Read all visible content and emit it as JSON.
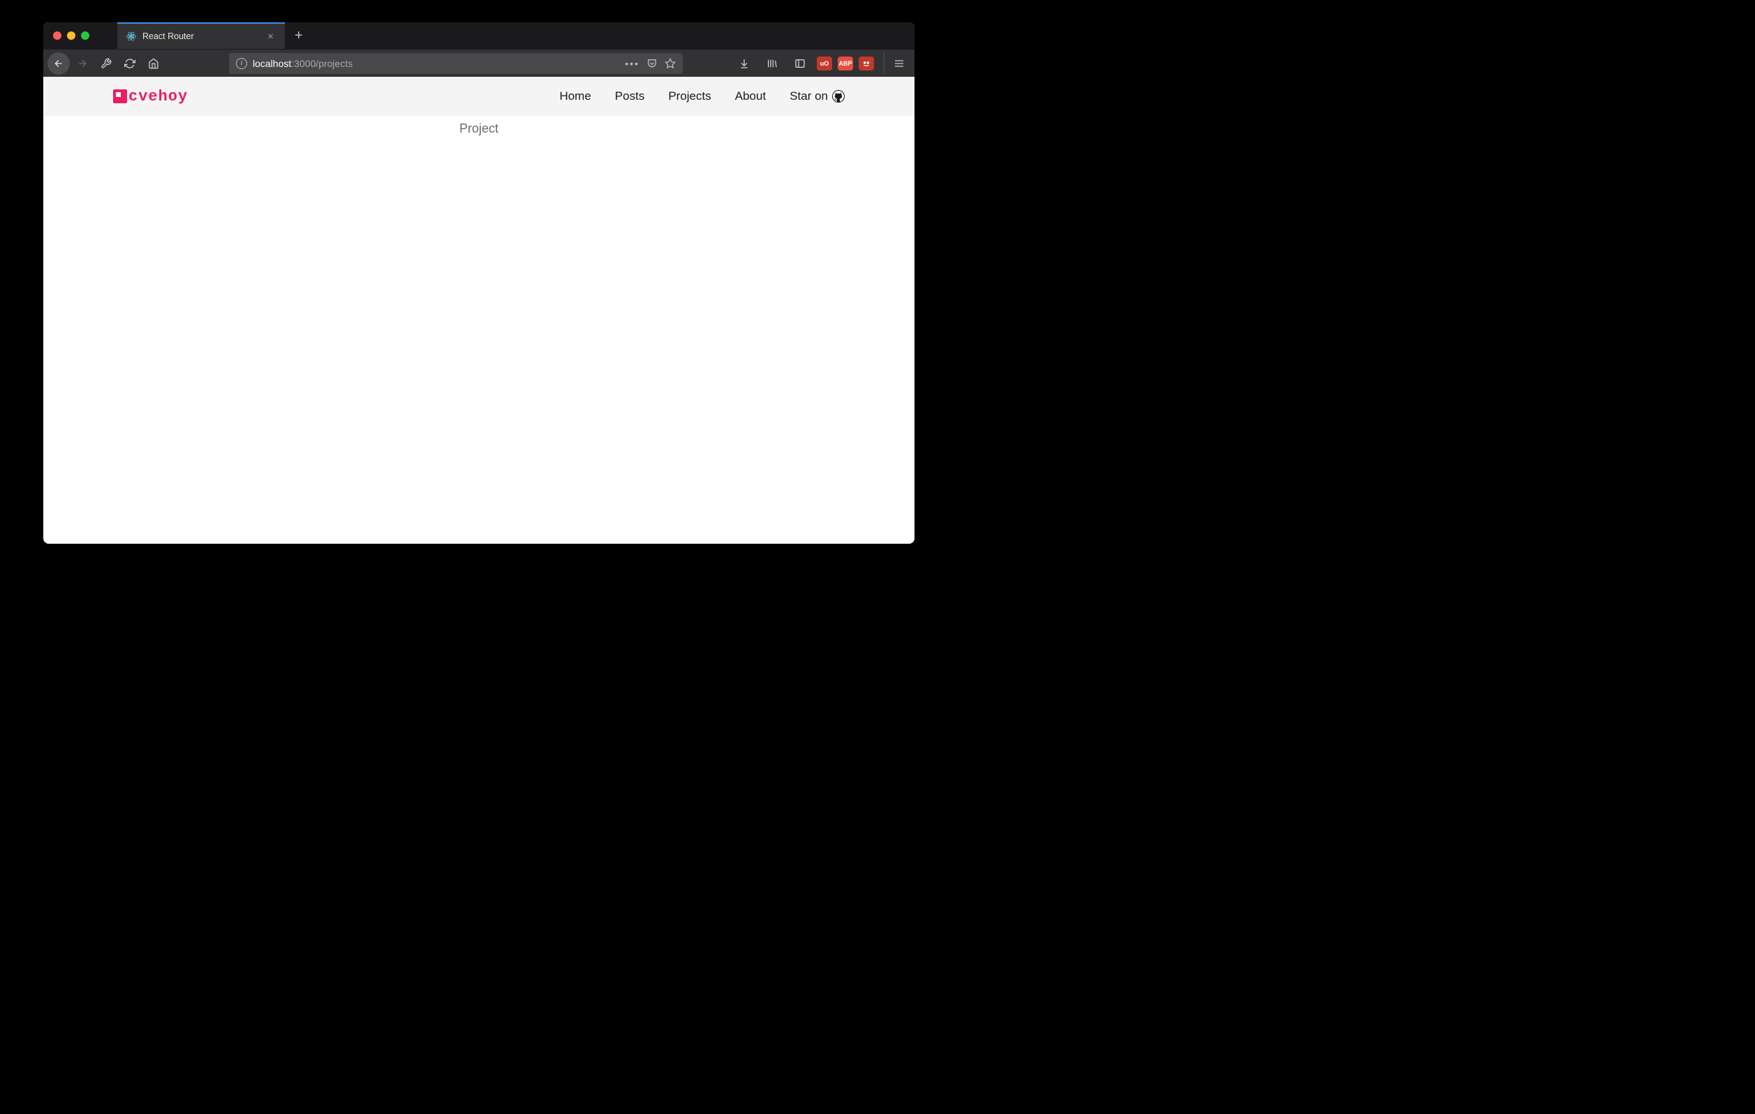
{
  "window": {
    "controls": {
      "close": "close",
      "minimize": "minimize",
      "maximize": "maximize"
    }
  },
  "tab": {
    "title": "React Router",
    "icon": "react-icon"
  },
  "toolbar": {
    "back": "back",
    "forward": "forward",
    "devtools": "wrench",
    "reload": "reload",
    "home": "home",
    "downloads": "downloads",
    "library": "library",
    "sidebar": "sidebar",
    "menu": "menu"
  },
  "url": {
    "host": "localhost",
    "port_path": ":3000/projects"
  },
  "urlbar_actions": {
    "more": "more",
    "pocket": "pocket",
    "bookmark": "bookmark"
  },
  "extensions": [
    {
      "name": "ublock",
      "label": "uO",
      "color": "#8e1a1a"
    },
    {
      "name": "adblock",
      "label": "ABP",
      "color": "#d9332b"
    },
    {
      "name": "tampermonkey",
      "label": "",
      "color": "#9a2a2a"
    }
  ],
  "site": {
    "logo_text": "cvehoy",
    "nav": [
      {
        "id": "home",
        "label": "Home"
      },
      {
        "id": "posts",
        "label": "Posts"
      },
      {
        "id": "projects",
        "label": "Projects"
      },
      {
        "id": "about",
        "label": "About"
      },
      {
        "id": "star",
        "label": "Star on"
      }
    ],
    "page_title": "Project"
  },
  "colors": {
    "accent": "#e91e63",
    "toolbar": "#323234",
    "titlebar": "#1a1a1d",
    "header_bg": "#f4f4f4"
  }
}
